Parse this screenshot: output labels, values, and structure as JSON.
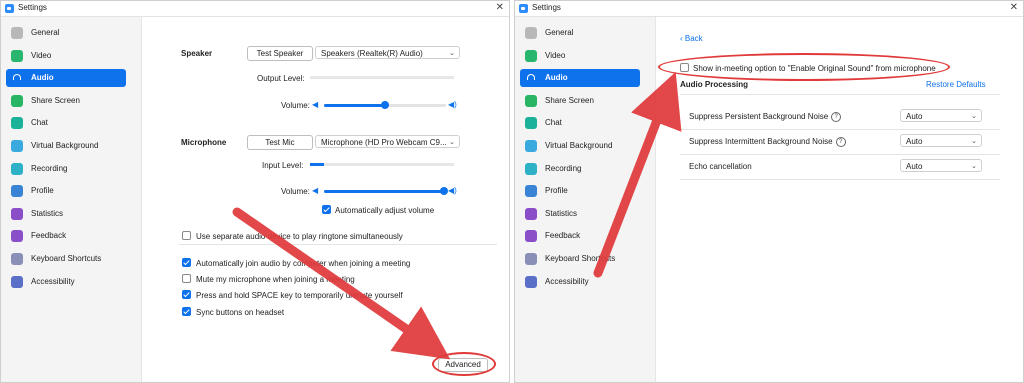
{
  "left": {
    "window_title": "Settings",
    "close_glyph": "✕",
    "sidebar": [
      {
        "label": "General",
        "icon": "general-icon",
        "color": "#b8b8b8"
      },
      {
        "label": "Video",
        "icon": "video-icon",
        "color": "#28b56d"
      },
      {
        "label": "Audio",
        "icon": "headphones-icon",
        "color": "#0e72ed"
      },
      {
        "label": "Share Screen",
        "icon": "share-screen-icon",
        "color": "#2ab565"
      },
      {
        "label": "Chat",
        "icon": "chat-icon",
        "color": "#1bb29a"
      },
      {
        "label": "Virtual Background",
        "icon": "virtual-background-icon",
        "color": "#3aa9de"
      },
      {
        "label": "Recording",
        "icon": "recording-icon",
        "color": "#2eb1c7"
      },
      {
        "label": "Profile",
        "icon": "profile-icon",
        "color": "#3a84d6"
      },
      {
        "label": "Statistics",
        "icon": "statistics-icon",
        "color": "#8a4ec8"
      },
      {
        "label": "Feedback",
        "icon": "feedback-icon",
        "color": "#8a4ec8"
      },
      {
        "label": "Keyboard Shortcuts",
        "icon": "keyboard-icon",
        "color": "#8a8fb8"
      },
      {
        "label": "Accessibility",
        "icon": "accessibility-icon",
        "color": "#5a6fc7"
      }
    ],
    "speaker": {
      "heading": "Speaker",
      "test_button": "Test Speaker",
      "device": "Speakers (Realtek(R) Audio)",
      "output_level_label": "Output Level:",
      "volume_label": "Volume:",
      "volume_fraction": 0.5,
      "output_level_fraction": 0
    },
    "microphone": {
      "heading": "Microphone",
      "test_button": "Test Mic",
      "device": "Microphone (HD Pro Webcam C9...",
      "input_level_label": "Input Level:",
      "volume_label": "Volume:",
      "volume_fraction": 0.98,
      "input_level_fraction": 0.1,
      "auto_adjust_label": "Automatically adjust volume",
      "auto_adjust_checked": true
    },
    "options": [
      {
        "label": "Use separate audio device to play ringtone simultaneously",
        "checked": false
      },
      {
        "label": "Automatically join audio by computer when joining a meeting",
        "checked": true
      },
      {
        "label": "Mute my microphone when joining a meeting",
        "checked": false
      },
      {
        "label": "Press and hold SPACE key to temporarily unmute yourself",
        "checked": true
      },
      {
        "label": "Sync buttons on headset",
        "checked": true
      }
    ],
    "advanced_button": "Advanced"
  },
  "right": {
    "window_title": "Settings",
    "close_glyph": "✕",
    "back_label": "Back",
    "original_sound_option": "Show in-meeting option to \"Enable Original Sound\" from microphone",
    "original_sound_checked": false,
    "section_title": "Audio Processing",
    "restore_defaults": "Restore Defaults",
    "rows": [
      {
        "label": "Suppress Persistent Background Noise",
        "help": true,
        "value": "Auto"
      },
      {
        "label": "Suppress Intermittent Background Noise",
        "help": true,
        "value": "Auto"
      },
      {
        "label": "Echo cancellation",
        "help": false,
        "value": "Auto"
      }
    ]
  },
  "colors": {
    "accent": "#0e72ed",
    "annotation": "#e0393a"
  }
}
